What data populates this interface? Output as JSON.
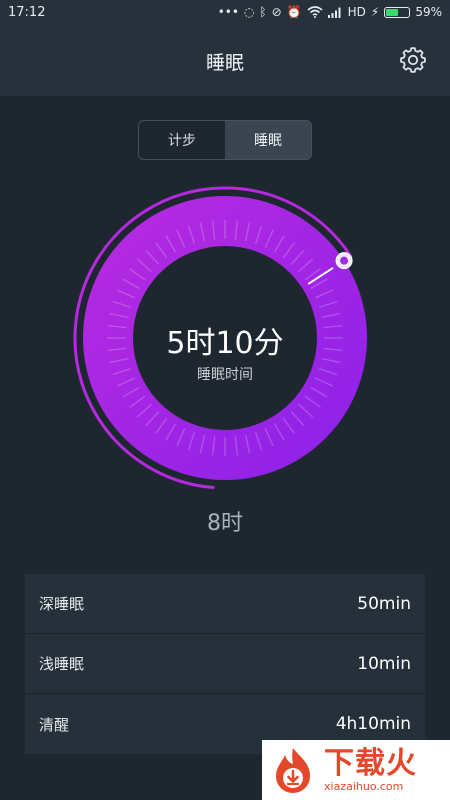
{
  "status_bar": {
    "time": "17:12",
    "network": "HD",
    "battery_percent": "59%",
    "battery_level": 0.59,
    "battery_color": "#3fd86b",
    "icons": [
      "dots-icon",
      "alarm-sync-icon",
      "bluetooth-icon",
      "vibrate-off-icon",
      "alarm-clock-icon",
      "wifi-icon",
      "signal-icon",
      "charging-icon",
      "battery-icon"
    ]
  },
  "header": {
    "title": "睡眠",
    "settings_icon": "gear-icon"
  },
  "tabs": [
    {
      "label": "计步",
      "active": false
    },
    {
      "label": "睡眠",
      "active": true
    }
  ],
  "ring": {
    "value_text": "5时10分",
    "label": "睡眠时间",
    "progress_fraction": 0.6458,
    "gradient_start": "#b52ae0",
    "gradient_end": "#8f22e8"
  },
  "goal": "8时",
  "stats": [
    {
      "label": "深睡眠",
      "value": "50min"
    },
    {
      "label": "浅睡眠",
      "value": "10min"
    },
    {
      "label": "清醒",
      "value": "4h10min"
    }
  ],
  "watermark": {
    "text_cn": "下载火",
    "text_en": "xiazaihuo.com",
    "logo_icon": "flame-download-icon"
  }
}
